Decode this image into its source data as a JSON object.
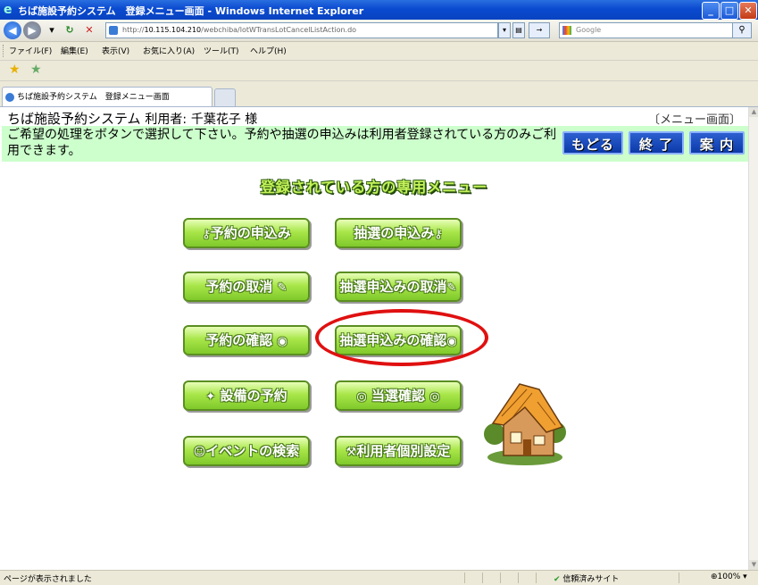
{
  "window": {
    "title": "ちば施設予約システム　登録メニュー画面 - Windows Internet Explorer",
    "minimize": "_",
    "maximize": "□",
    "close": "✕"
  },
  "toolbar": {
    "address_prefix": "http://",
    "address_host": "10.115.104.210",
    "address_path": "/webchiba/lotWTransLotCancelListAction.do",
    "search_placeholder": "Google"
  },
  "menubar": {
    "items": [
      "ファイル(F)",
      "編集(E)",
      "表示(V)",
      "お気に入り(A)",
      "ツール(T)",
      "ヘルプ(H)"
    ]
  },
  "tab": {
    "label": "ちば施設予約システム　登録メニュー画面"
  },
  "page": {
    "system_name": "ちば施設予約システム",
    "user_prefix": "利用者:",
    "user_name": "千葉花子 様",
    "screen_name": "〔メニュー画面〕",
    "guide_text": "ご希望の処理をボタンで選択して下さい。予約や抽選の申込みは利用者登録されている方のみご利用できます。",
    "btn_back": "もどる",
    "btn_exit": "終 了",
    "btn_help": "案 内",
    "menu_title": "登録されている方の専用メニュー",
    "menu": {
      "reserve_apply": "予約の申込み",
      "lottery_apply": "抽選の申込み",
      "reserve_cancel": "予約の取消",
      "lottery_cancel": "抽選申込みの取消",
      "reserve_confirm": "予約の確認",
      "lottery_confirm": "抽選申込みの確認",
      "equipment_reserve": "設備の予約",
      "win_confirm": "当選確認",
      "event_search": "イベントの検索",
      "user_settings": "利用者個別設定"
    }
  },
  "status": {
    "message": "ページが表示されました",
    "zone": "信頼済みサイト",
    "zoom": "100%"
  },
  "colors": {
    "accent": "#0a4ad0",
    "guide_bg": "#ccffcc",
    "button_green": "#a9e64a",
    "highlight": "#e01010"
  }
}
